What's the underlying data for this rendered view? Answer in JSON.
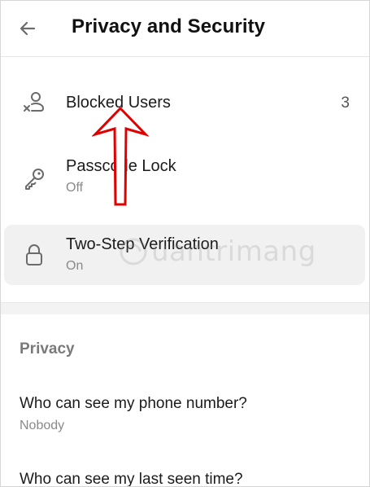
{
  "header": {
    "back_icon": "arrow-left-icon",
    "title": "Privacy and Security"
  },
  "security_items": [
    {
      "icon": "user-block-icon",
      "label": "Blocked Users",
      "value": "3"
    },
    {
      "icon": "key-icon",
      "label": "Passcode Lock",
      "value": "Off"
    },
    {
      "icon": "lock-icon",
      "label": "Two-Step Verification",
      "value": "On"
    }
  ],
  "privacy": {
    "section_title": "Privacy",
    "items": [
      {
        "label": "Who can see my phone number?",
        "value": "Nobody"
      },
      {
        "label": "Who can see my last seen time?"
      }
    ]
  },
  "watermark": {
    "text": "uantrimang"
  },
  "colors": {
    "accent_arrow": "#e00000",
    "highlight": "#f1f1f2",
    "subtext": "#8a8a8a",
    "section_title": "#7a7a7a"
  }
}
